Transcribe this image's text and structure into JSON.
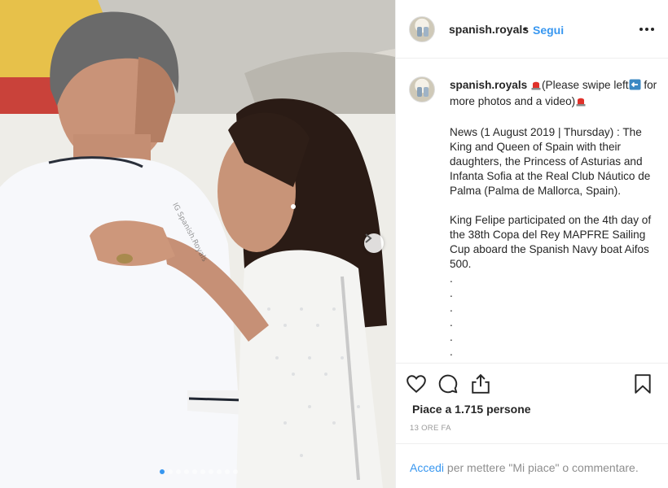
{
  "post": {
    "photo_watermark": "IG Spanish.Royals",
    "carousel": {
      "slides": 10,
      "active_index": 0
    }
  },
  "header": {
    "username": "spanish.royals",
    "separator": "•",
    "follow_label": "Segui"
  },
  "caption": {
    "username": "spanish.royals",
    "intro": "(Please swipe left",
    "intro_end": "for more photos and a video)",
    "paragraph1": "News (1 August 2019 | Thursday) : The King and Queen of Spain with their daughters, the Princess of Asturias and Infanta Sofia at the Real Club Náutico de Palma (Palma de Mallorca, Spain).",
    "paragraph2": "King Felipe participated on the 4th day of the 38th Copa del Rey MAPFRE Sailing Cup aboard the Spanish Navy boat Aifos 500.",
    "dots": [
      ".",
      ".",
      ".",
      ".",
      ".",
      "."
    ]
  },
  "stats": {
    "likes": "Piace a 1.715 persone",
    "time_ago": "13 ORE FA"
  },
  "footer": {
    "login_link": "Accedi",
    "login_text": " per mettere \"Mi piace\" o commentare."
  },
  "icons": {
    "siren": "siren-emoji-icon",
    "left_arrow": "left-arrow-emoji-icon",
    "like": "heart-icon",
    "comment": "comment-icon",
    "share": "share-icon",
    "save": "bookmark-icon",
    "more": "more-options-icon"
  },
  "colors": {
    "link_blue": "#3897f0",
    "text": "#262626",
    "muted": "#8e8e8e"
  }
}
